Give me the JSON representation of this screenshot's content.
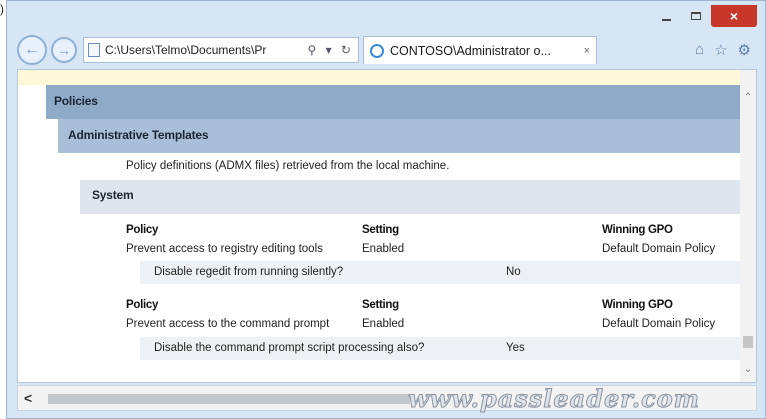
{
  "corner_label": ")",
  "window": {
    "close_label": "×"
  },
  "toolbar": {
    "back_glyph": "←",
    "forward_glyph": "→",
    "address_text": "C:\\Users\\Telmo\\Documents\\Pr",
    "address_tools": "⚲ ▾ ↻",
    "tab_title": "CONTOSO\\Administrator o...",
    "tab_close": "×",
    "home_glyph": "⌂",
    "favorites_glyph": "☆",
    "settings_glyph": "⚙"
  },
  "content": {
    "policies_header": "Policies",
    "admin_templates_header": "Administrative Templates",
    "description": "Policy definitions (ADMX files) retrieved from the local machine.",
    "system_header": "System",
    "blocks": [
      {
        "col_policy": "Policy",
        "col_setting": "Setting",
        "col_gpo": "Winning GPO",
        "policy": "Prevent access to registry editing tools",
        "setting": "Enabled",
        "gpo": "Default Domain Policy",
        "sub_label": "Disable regedit from running silently?",
        "sub_value": "No"
      },
      {
        "col_policy": "Policy",
        "col_setting": "Setting",
        "col_gpo": "Winning GPO",
        "policy": "Prevent access to the command prompt",
        "setting": "Enabled",
        "gpo": "Default Domain Policy",
        "sub_label": "Disable the command prompt script processing also?",
        "sub_value": "Yes"
      }
    ]
  },
  "scrollbar": {
    "left_arrow": "<",
    "up_arrow": "⌃",
    "down_arrow": "⌄"
  },
  "watermark": "www.passleader.com"
}
